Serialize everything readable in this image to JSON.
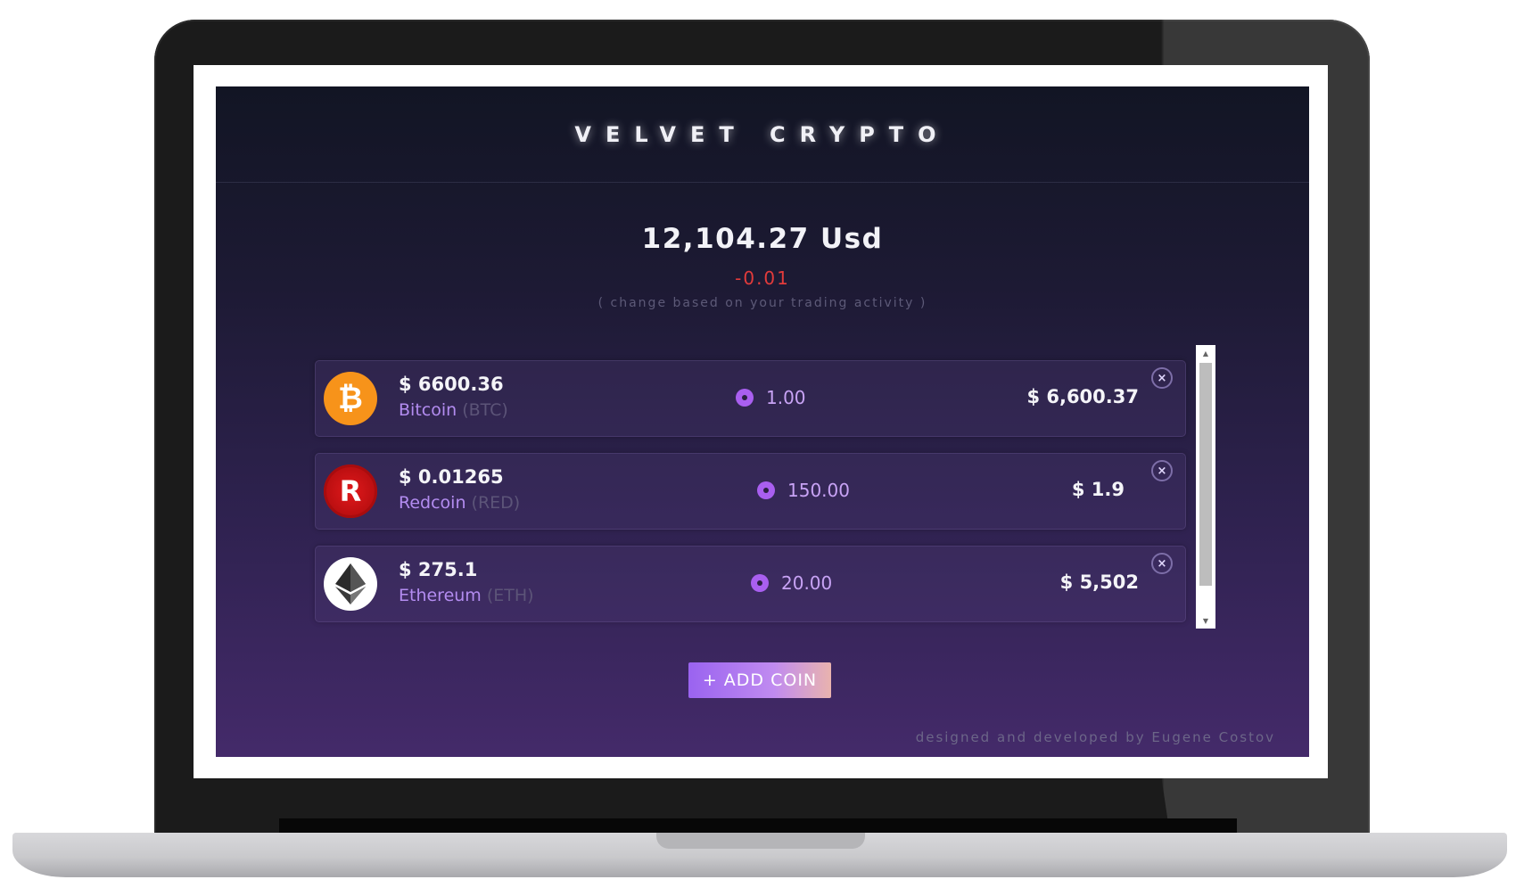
{
  "app": {
    "brand": "VELVET CRYPTO"
  },
  "summary": {
    "total": "12,104.27 Usd",
    "change": "-0.01",
    "change_note": "( change based on your trading activity )"
  },
  "coins": [
    {
      "price": "$ 6600.36",
      "name": "Bitcoin",
      "symbol": "(BTC)",
      "amount": "1.00",
      "value": "$ 6,600.37",
      "logo_icon": "bitcoin-logo-icon",
      "logo_glyph": "₿"
    },
    {
      "price": "$ 0.01265",
      "name": "Redcoin",
      "symbol": "(RED)",
      "amount": "150.00",
      "value": "$ 1.9",
      "logo_icon": "redcoin-logo-icon",
      "logo_glyph": "R"
    },
    {
      "price": "$ 275.1",
      "name": "Ethereum",
      "symbol": "(ETH)",
      "amount": "20.00",
      "value": "$ 5,502",
      "logo_icon": "ethereum-logo-icon"
    }
  ],
  "actions": {
    "add_coin": "+ ADD COIN",
    "remove_glyph": "×"
  },
  "scroll": {
    "up_glyph": "▲",
    "down_glyph": "▼"
  },
  "footer": {
    "credit": "designed and developed by Eugene Costov"
  },
  "colors": {
    "accent": "#a95ff0",
    "negative": "#e23b3b",
    "bitcoin": "#f7931a",
    "redcoin": "#d0131a"
  }
}
